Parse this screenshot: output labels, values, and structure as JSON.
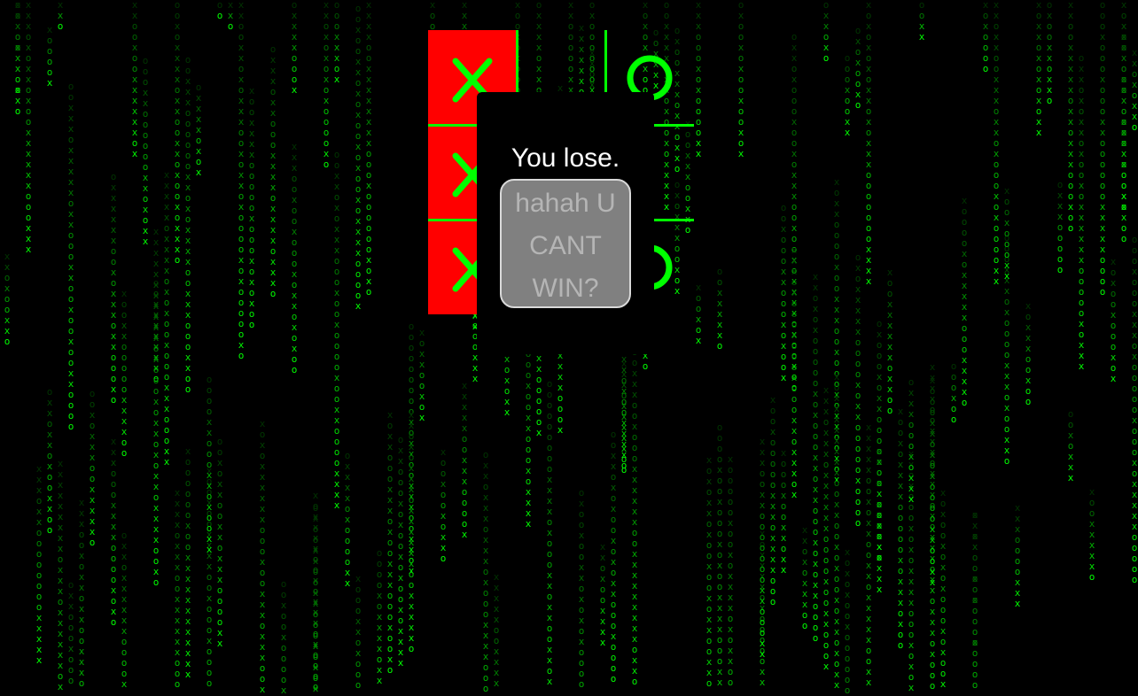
{
  "game": {
    "board": [
      "X",
      "",
      "O",
      "X",
      "",
      "",
      "X",
      "",
      "O"
    ],
    "winning_cells": [
      0,
      3,
      6
    ]
  },
  "dialog": {
    "result_text": "You lose.",
    "button_label": "hahah U CANT WIN?"
  },
  "background": {
    "effect": "matrix-rain",
    "glyphs": [
      "x",
      "o"
    ]
  },
  "colors": {
    "background": "#000000",
    "mark": "#00ff00",
    "win_highlight": "#ff0000",
    "dialog_bg": "#000000",
    "dialog_text": "#ffffff",
    "button_bg": "#808080",
    "button_text": "#b5b5b5",
    "button_border": "#d9d9d9"
  }
}
